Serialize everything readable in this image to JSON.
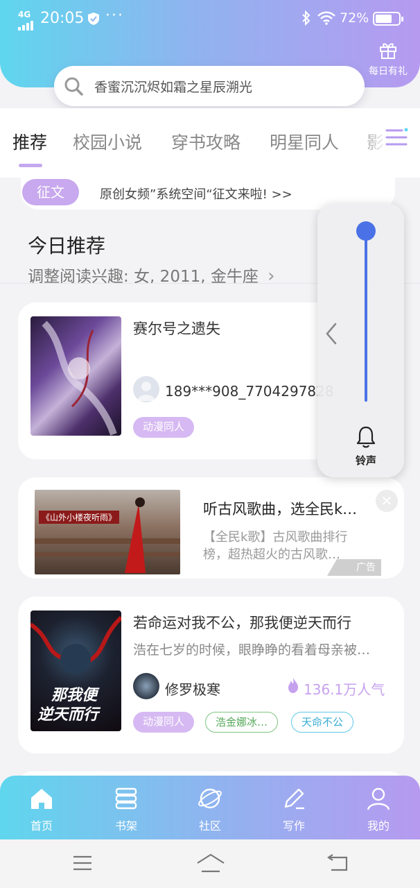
{
  "status_bar": {
    "network": "4G",
    "time": "20:05",
    "dots": "···",
    "battery_percent": "72%",
    "battery_level": 0.72
  },
  "header": {
    "gift_label": "每日有礼",
    "search_placeholder": "香蜜沉沉烬如霜之星辰溯光"
  },
  "tabs": [
    {
      "label": "推荐",
      "active": true
    },
    {
      "label": "校园小说"
    },
    {
      "label": "穿书攻略"
    },
    {
      "label": "明星同人"
    },
    {
      "label": "影视"
    }
  ],
  "notice": {
    "tag": "征文",
    "text": "原创女频”系统空间“征文来啦! >>"
  },
  "recommend": {
    "title": "今日推荐",
    "subtitle": "调整阅读兴趣: 女, 2011, 金牛座",
    "chevron": "›"
  },
  "books": [
    {
      "title": "赛尔号之遗失",
      "author": "189***908_7704297828",
      "tags": [
        "动漫同人"
      ]
    },
    {
      "title": "若命运对我不公，那我便逆天而行",
      "desc": "浩在七岁的时候，眼睁睁的看着母亲被…",
      "author": "修罗极寒",
      "popularity": "136.1万人气",
      "tags": [
        "动漫同人",
        "浩金娜冰…",
        "天命不公"
      ],
      "cover_text_1": "那我便",
      "cover_text_2": "逆天而行"
    }
  ],
  "ad": {
    "title": "听古风歌曲，选全民k…",
    "desc": "【全民k歌】古风歌曲排行榜，超热超火的古风歌…",
    "badge": "广告",
    "close": "✕",
    "image_caption": "《山外小楼夜听雨》"
  },
  "volume_panel": {
    "label": "铃声",
    "level": 1.0
  },
  "bottom_nav": [
    {
      "label": "首页",
      "icon": "home-icon"
    },
    {
      "label": "书架",
      "icon": "bookshelf-icon"
    },
    {
      "label": "社区",
      "icon": "planet-icon"
    },
    {
      "label": "写作",
      "icon": "pen-icon"
    },
    {
      "label": "我的",
      "icon": "user-icon"
    }
  ],
  "colors": {
    "gradient_start": "#5fd6ee",
    "gradient_end": "#b69af0",
    "accent_purple": "#c4a7ef",
    "slider_blue": "#4a72e6"
  }
}
